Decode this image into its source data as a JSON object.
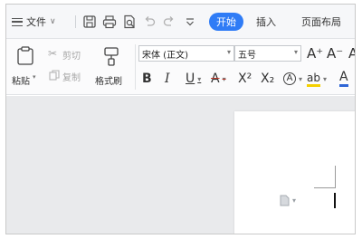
{
  "titlebar": {
    "menu_label": "文件",
    "tabs": [
      {
        "label": "开始",
        "active": true
      },
      {
        "label": "插入",
        "active": false
      },
      {
        "label": "页面布局",
        "active": false
      }
    ]
  },
  "ribbon": {
    "clipboard": {
      "paste": "粘贴",
      "cut": "剪切",
      "copy": "复制",
      "format_painter": "格式刷"
    },
    "font": {
      "font_name": "宋体 (正文)",
      "font_size": "五号",
      "bold": "B",
      "italic": "I",
      "underline": "U",
      "strikethrough": "A",
      "superscript": "X²",
      "subscript": "X₂",
      "grow": "A⁺",
      "shrink": "A⁻",
      "clear": "A",
      "highlight": "ab",
      "font_color": "A"
    }
  },
  "colors": {
    "accent": "#2f7cf6",
    "workspace": "#e9eaec",
    "highlight": "#f5d000",
    "font_color": "#2f66d6"
  }
}
